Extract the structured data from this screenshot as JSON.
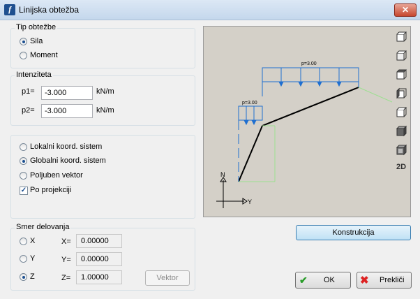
{
  "window": {
    "title": "Linijska obtežba",
    "close_glyph": "✕"
  },
  "tip": {
    "label": "Tip obtežbe",
    "options": [
      {
        "label": "Sila",
        "selected": true
      },
      {
        "label": "Moment",
        "selected": false
      }
    ]
  },
  "intenziteta": {
    "label": "Intenziteta",
    "p1": {
      "label": "p1=",
      "value": "-3.000",
      "unit": "kN/m"
    },
    "p2": {
      "label": "p2=",
      "value": "-3.000",
      "unit": "kN/m"
    }
  },
  "coords": {
    "options": [
      {
        "label": "Lokalni koord. sistem",
        "selected": false
      },
      {
        "label": "Globalni koord. sistem",
        "selected": true
      },
      {
        "label": "Poljuben vektor",
        "selected": false
      }
    ],
    "projection": {
      "label": "Po projekciji",
      "checked": true
    }
  },
  "smer": {
    "label": "Smer delovanja",
    "rows": [
      {
        "label": "X",
        "eq": "X=",
        "value": "0.00000",
        "selected": false
      },
      {
        "label": "Y",
        "eq": "Y=",
        "value": "0.00000",
        "selected": false
      },
      {
        "label": "Z",
        "eq": "Z=",
        "value": "1.00000",
        "selected": true
      }
    ],
    "vector_button": "Vektor"
  },
  "preview": {
    "load_label_1": "p=3.00",
    "load_label_2": "p=3.00",
    "axis_vertical": "N",
    "axis_horizontal": "Y",
    "view_2d": "2D",
    "view_icons": [
      "view-cube-1-icon",
      "view-cube-2-icon",
      "view-cube-3-icon",
      "view-cube-4-icon",
      "view-cube-5-icon",
      "view-cube-6-icon",
      "view-cube-7-icon"
    ]
  },
  "buttons": {
    "konstrukcija": "Konstrukcija",
    "ok": "OK",
    "cancel": "Prekliči"
  },
  "colors": {
    "accent": "#1a4e8f",
    "load_blue": "#1f6fd0",
    "green": "#5fcf4f"
  }
}
